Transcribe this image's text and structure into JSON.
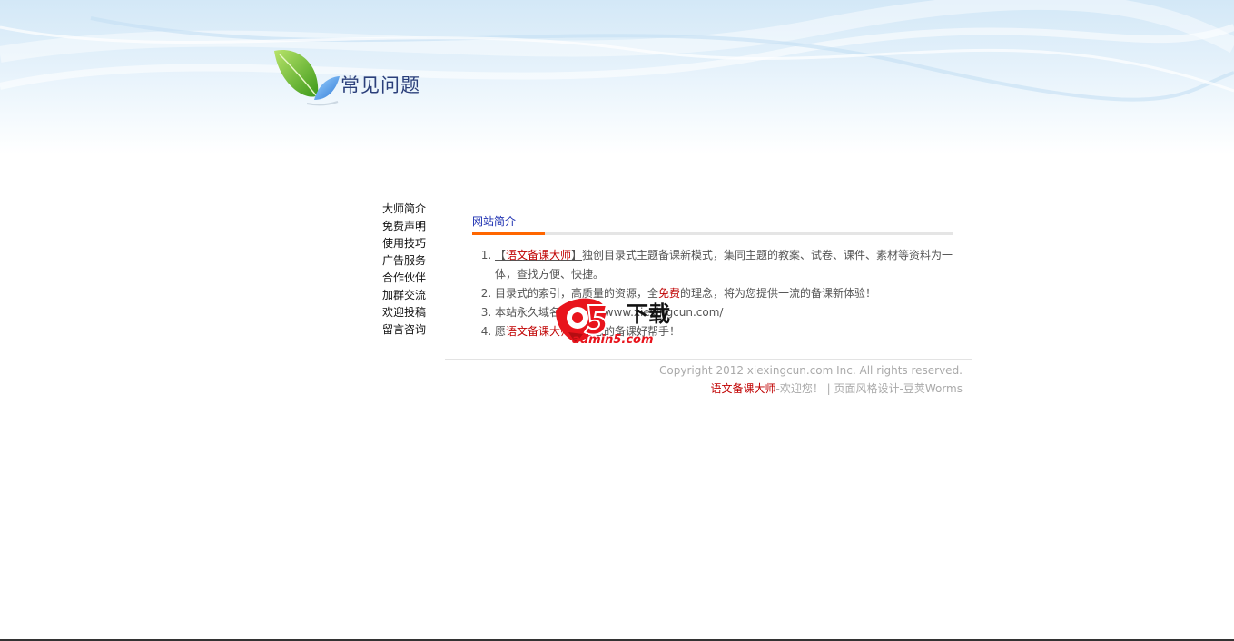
{
  "header": {
    "title": "常见问题"
  },
  "sidebar": {
    "items": [
      {
        "label": "大师简介"
      },
      {
        "label": "免费声明"
      },
      {
        "label": "使用技巧"
      },
      {
        "label": "广告服务"
      },
      {
        "label": "合作伙伴"
      },
      {
        "label": "加群交流"
      },
      {
        "label": "欢迎投稿"
      },
      {
        "label": "留言咨询"
      }
    ]
  },
  "content": {
    "tab_label": "网站简介",
    "items": [
      {
        "link_open": "【",
        "link_text": "语文备课大师",
        "link_close": "】",
        "text": "独创目录式主题备课新模式，集同主题的教案、试卷、课件、素材等资料为一体，查找方便、快捷。"
      },
      {
        "text_before": "目录式的索引，高质量的资源，全",
        "highlight": "免费",
        "text_after": "的理念，将为您提供一流的备课新体验！"
      },
      {
        "text": "本站永久域名：http://www.xiexingcun.com/"
      },
      {
        "text_before": "愿",
        "highlight": "语文备课大师",
        "text_after": "成为您的备课好帮手！"
      }
    ]
  },
  "footer": {
    "copyright": "Copyright 2012 xiexingcun.com Inc. All rights reserved.",
    "brand": "语文备课大师",
    "welcome": "-欢迎您！ | 页面风格设计-豆荚Worms"
  },
  "watermark": {
    "brand_text": "下载",
    "domain": "admin5.com"
  },
  "colors": {
    "accent": "#ff6600",
    "link": "#c00000",
    "tab": "#1a2db0"
  }
}
